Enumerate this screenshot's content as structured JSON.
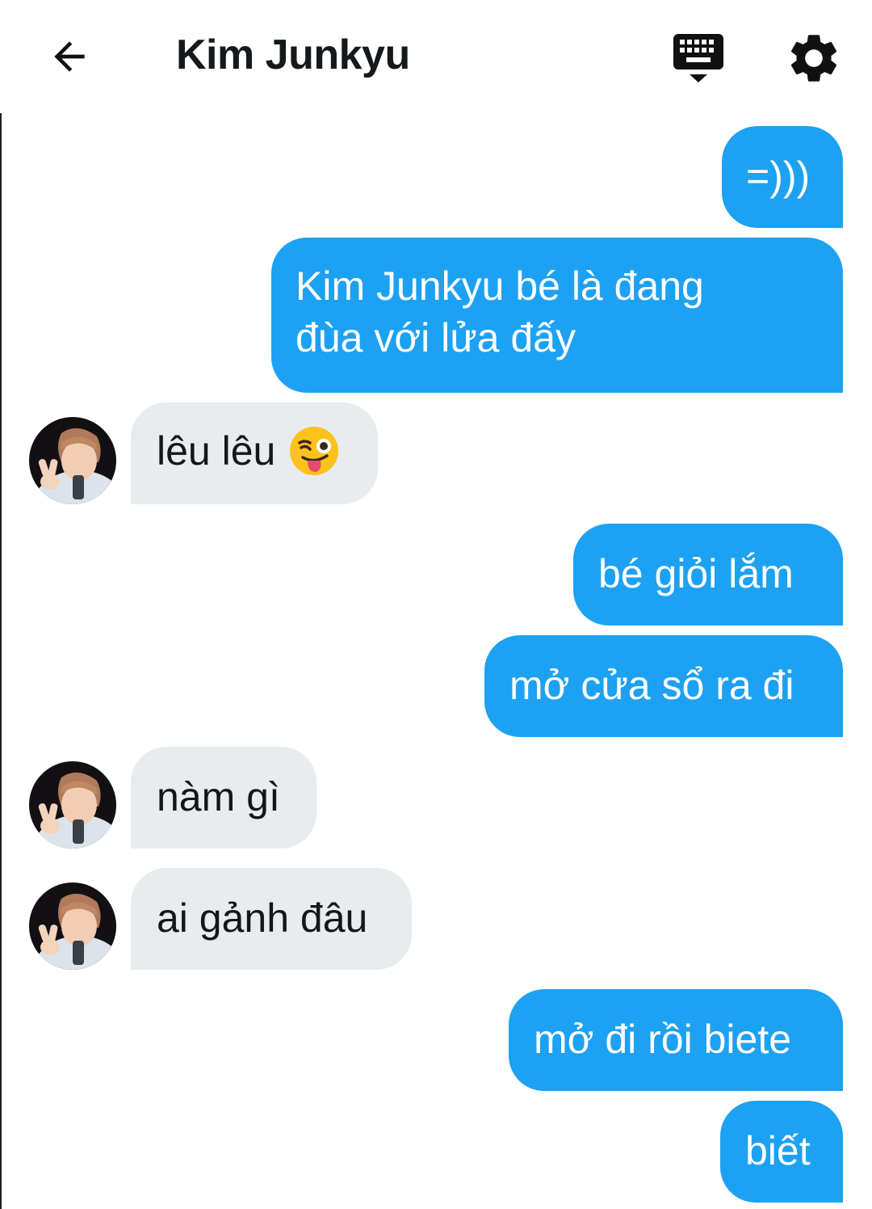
{
  "header": {
    "title": "Kim Junkyu",
    "back_icon": "arrow-left-icon",
    "keyboard_icon": "keyboard-hide-icon",
    "settings_icon": "gear-icon"
  },
  "colors": {
    "outgoing_bubble": "#1da1f2",
    "incoming_bubble": "#e8ecef",
    "outgoing_text": "#ffffff",
    "incoming_text": "#14171a"
  },
  "messages": [
    {
      "sender": "me",
      "text": "=)))"
    },
    {
      "sender": "me",
      "lines": [
        "Kim Junkyu bé là đang",
        "đùa với lửa đấy"
      ]
    },
    {
      "sender": "Kim Junkyu",
      "text": "lêu lêu",
      "emoji": "winking-face-with-tongue"
    },
    {
      "sender": "me",
      "text": "bé giỏi lắm"
    },
    {
      "sender": "me",
      "text": "mở cửa sổ ra đi"
    },
    {
      "sender": "Kim Junkyu",
      "text": "nàm gì"
    },
    {
      "sender": "Kim Junkyu",
      "text": "ai gảnh đâu"
    },
    {
      "sender": "me",
      "text": "mở đi rồi biete"
    },
    {
      "sender": "me",
      "text": "biết"
    }
  ]
}
